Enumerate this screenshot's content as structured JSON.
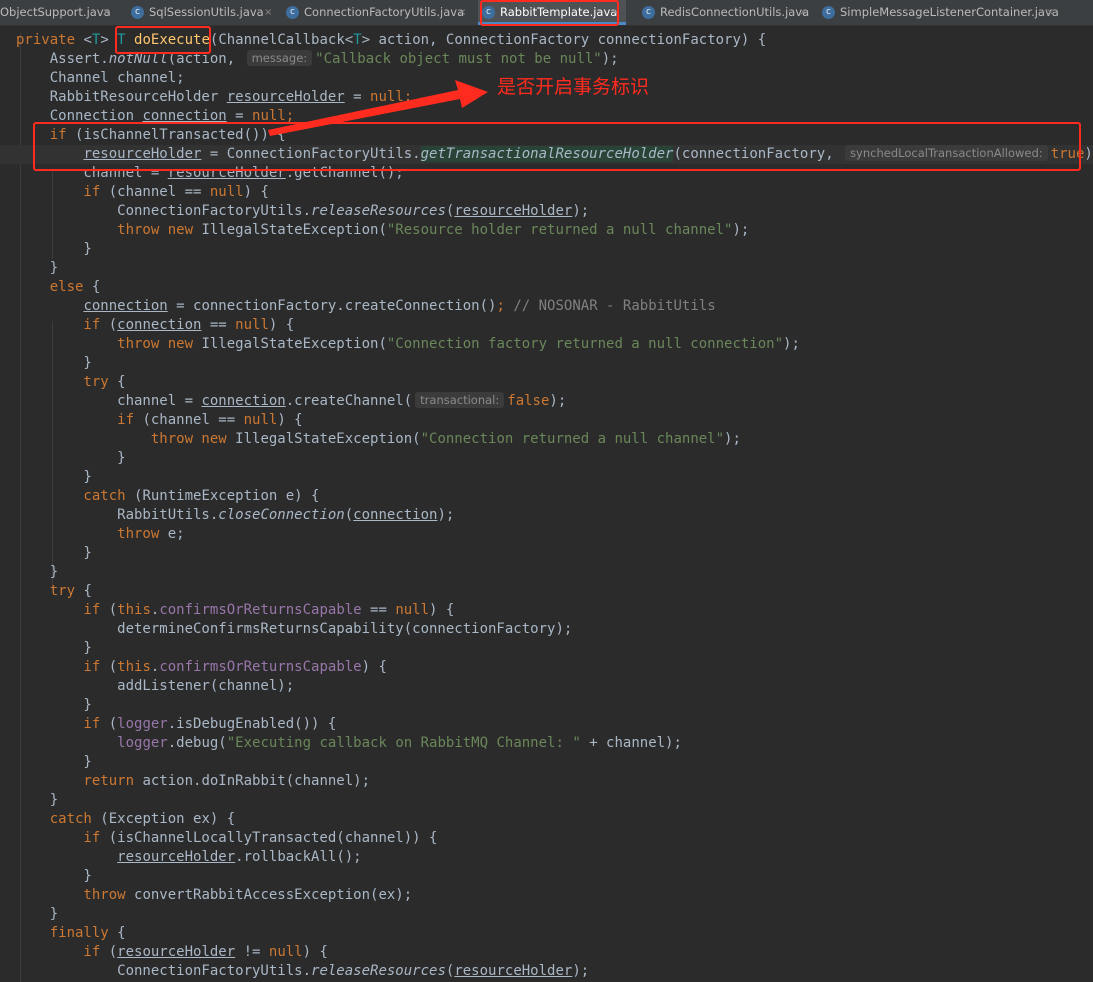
{
  "tabs": [
    {
      "label": "ObjectSupport.java",
      "active": false
    },
    {
      "label": "SqlSessionUtils.java",
      "active": false
    },
    {
      "label": "ConnectionFactoryUtils.java",
      "active": false
    },
    {
      "label": "RabbitTemplate.java",
      "active": true
    },
    {
      "label": "RedisConnectionUtils.java",
      "active": false
    },
    {
      "label": "SimpleMessageListenerContainer.java",
      "active": false
    }
  ],
  "tab_close_glyph": "×",
  "tab_icon_glyph": "c",
  "annotation": {
    "text": "是否开启事务标识",
    "color": "#ff2b1e"
  },
  "colors": {
    "background": "#2b2b2b",
    "keyword": "#cc7832",
    "string": "#6a8759",
    "field": "#9876aa",
    "text": "#a9b7c6"
  },
  "code": {
    "l1": {
      "kw": "private ",
      "gen_open": "<",
      "gen_t": "T",
      "gen_close": "> ",
      "ret": "T ",
      "name": "doExecute",
      "params": "(ChannelCallback<",
      "t": "T",
      "rest": "> action, ConnectionFactory connectionFactory) {"
    },
    "l2": {
      "a": "    Assert.",
      "b": "notNull",
      "c": "(action, ",
      "hint": "message:",
      "str": "\"Callback object must not be null\"",
      "d": ");"
    },
    "l3": {
      "a": "    Channel channel;"
    },
    "l4": {
      "a": "    RabbitResourceHolder ",
      "b": "resourceHolder",
      "c": " = ",
      "kw": "null",
      "d": ";"
    },
    "l5": {
      "a": "    Connection ",
      "b": "connection",
      "c": " = ",
      "kw": "null",
      "d": ";"
    },
    "l6": {
      "kw": "    if ",
      "a": "(isChannelTransacted()) {"
    },
    "l7": {
      "a": "        ",
      "b": "resourceHolder",
      "c": " = ConnectionFactoryUtils.",
      "d": "getTransactionalResourceHolder",
      "e": "(connectionFactory, ",
      "hint": "synchedLocalTransactionAllowed:",
      "kw": "true",
      "f": ");"
    },
    "l8": {
      "a": "        channel = ",
      "b": "resourceHolder",
      "c": ".getChannel();"
    },
    "l9": {
      "kw": "        if ",
      "a": "(channel == ",
      "kw2": "null",
      "b": ") {"
    },
    "l10": {
      "a": "            ConnectionFactoryUtils.",
      "b": "releaseResources",
      "c": "(",
      "d": "resourceHolder",
      "e": ");"
    },
    "l11": {
      "kw": "            throw new ",
      "a": "IllegalStateException(",
      "str": "\"Resource holder returned a null channel\"",
      "b": ");"
    },
    "l12": {
      "a": "        }"
    },
    "l13": {
      "a": "    }"
    },
    "l14": {
      "kw": "    else ",
      "a": "{"
    },
    "l15": {
      "a": "        ",
      "b": "connection",
      "c": " = connectionFactory.createConnection()",
      "kw": ";",
      "cm": " // NOSONAR - RabbitUtils"
    },
    "l16": {
      "kw": "        if ",
      "a": "(",
      "b": "connection",
      "c": " == ",
      "kw2": "null",
      "d": ") {"
    },
    "l17": {
      "kw": "            throw new ",
      "a": "IllegalStateException(",
      "str": "\"Connection factory returned a null connection\"",
      "b": ");"
    },
    "l18": {
      "a": "        }"
    },
    "l19": {
      "kw": "        try ",
      "a": "{"
    },
    "l20": {
      "a": "            channel = ",
      "b": "connection",
      "c": ".createChannel(",
      "hint": "transactional:",
      "kw": "false",
      "d": ");"
    },
    "l21": {
      "kw": "            if ",
      "a": "(channel == ",
      "kw2": "null",
      "b": ") {"
    },
    "l22": {
      "kw": "                throw new ",
      "a": "IllegalStateException(",
      "str": "\"Connection returned a null channel\"",
      "b": ");"
    },
    "l23": {
      "a": "            }"
    },
    "l24": {
      "a": "        }"
    },
    "l25": {
      "kw": "        catch ",
      "a": "(RuntimeException e) {"
    },
    "l26": {
      "a": "            RabbitUtils.",
      "b": "closeConnection",
      "c": "(",
      "d": "connection",
      "e": ");"
    },
    "l27": {
      "kw": "            throw ",
      "a": "e;"
    },
    "l28": {
      "a": "        }"
    },
    "l29": {
      "a": "    }"
    },
    "l30": {
      "kw": "    try ",
      "a": "{"
    },
    "l31": {
      "kw": "        if ",
      "a": "(",
      "kw2": "this",
      "b": ".",
      "f": "confirmsOrReturnsCapable",
      "c": " == ",
      "kw3": "null",
      "d": ") {"
    },
    "l32": {
      "a": "            determineConfirmsReturnsCapability(connectionFactory);"
    },
    "l33": {
      "a": "        }"
    },
    "l34": {
      "kw": "        if ",
      "a": "(",
      "kw2": "this",
      "b": ".",
      "f": "confirmsOrReturnsCapable",
      "c": ") {"
    },
    "l35": {
      "a": "            addListener(channel);"
    },
    "l36": {
      "a": "        }"
    },
    "l37": {
      "kw": "        if ",
      "a": "(",
      "f": "logger",
      "b": ".isDebugEnabled()) {"
    },
    "l38": {
      "a": "            ",
      "f": "logger",
      "b": ".debug(",
      "str": "\"Executing callback on RabbitMQ Channel: \"",
      "c": " + channel);"
    },
    "l39": {
      "a": "        }"
    },
    "l40": {
      "kw": "        return ",
      "a": "action.doInRabbit(channel);"
    },
    "l41": {
      "a": "    }"
    },
    "l42": {
      "kw": "    catch ",
      "a": "(Exception ex) {"
    },
    "l43": {
      "kw": "        if ",
      "a": "(isChannelLocallyTransacted(channel)) {"
    },
    "l44": {
      "a": "            ",
      "b": "resourceHolder",
      "c": ".rollbackAll();"
    },
    "l45": {
      "a": "        }"
    },
    "l46": {
      "kw": "        throw ",
      "a": "convertRabbitAccessException(ex);"
    },
    "l47": {
      "a": "    }"
    },
    "l48": {
      "kw": "    finally ",
      "a": "{"
    },
    "l49": {
      "kw": "        if ",
      "a": "(",
      "b": "resourceHolder",
      "c": " != ",
      "kw2": "null",
      "d": ") {"
    },
    "l50": {
      "a": "            ConnectionFactoryUtils.",
      "b": "releaseResources",
      "c": "(",
      "d": "resourceHolder",
      "e": ");"
    }
  }
}
